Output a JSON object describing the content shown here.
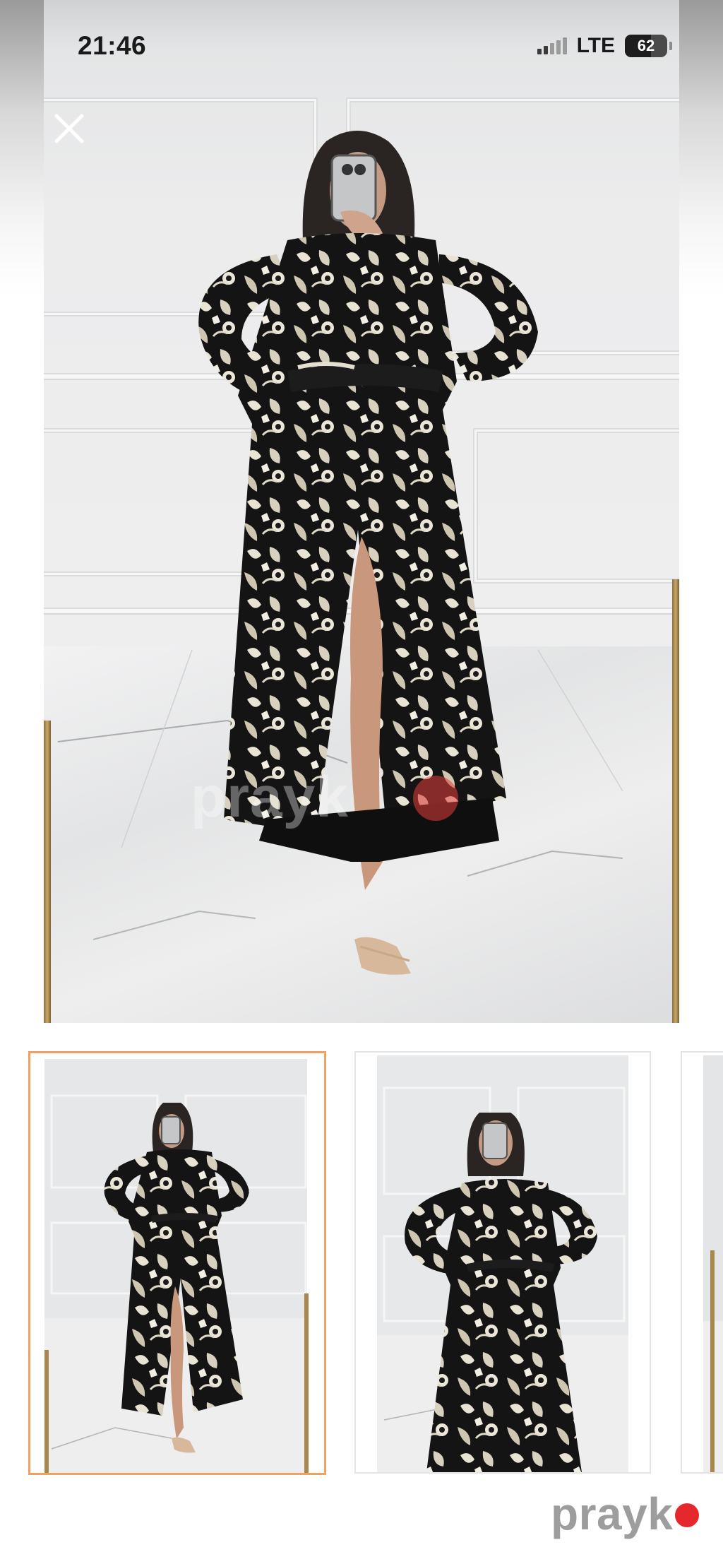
{
  "status_bar": {
    "time": "21:46",
    "network": "LTE",
    "battery_level": "62",
    "battery_fraction": 0.62
  },
  "viewer": {
    "close_icon": "close-icon",
    "watermark": "prayk"
  },
  "thumbnails": [
    {
      "id": "thumb-1",
      "selected": true
    },
    {
      "id": "thumb-2",
      "selected": false
    },
    {
      "id": "thumb-3",
      "selected": false
    }
  ],
  "brand": {
    "name": "prayk",
    "dot_color": "#e5282c"
  },
  "colors": {
    "selected_border": "#f0a060",
    "dress_dark": "#151515",
    "dress_print": "#e8e2d4"
  }
}
